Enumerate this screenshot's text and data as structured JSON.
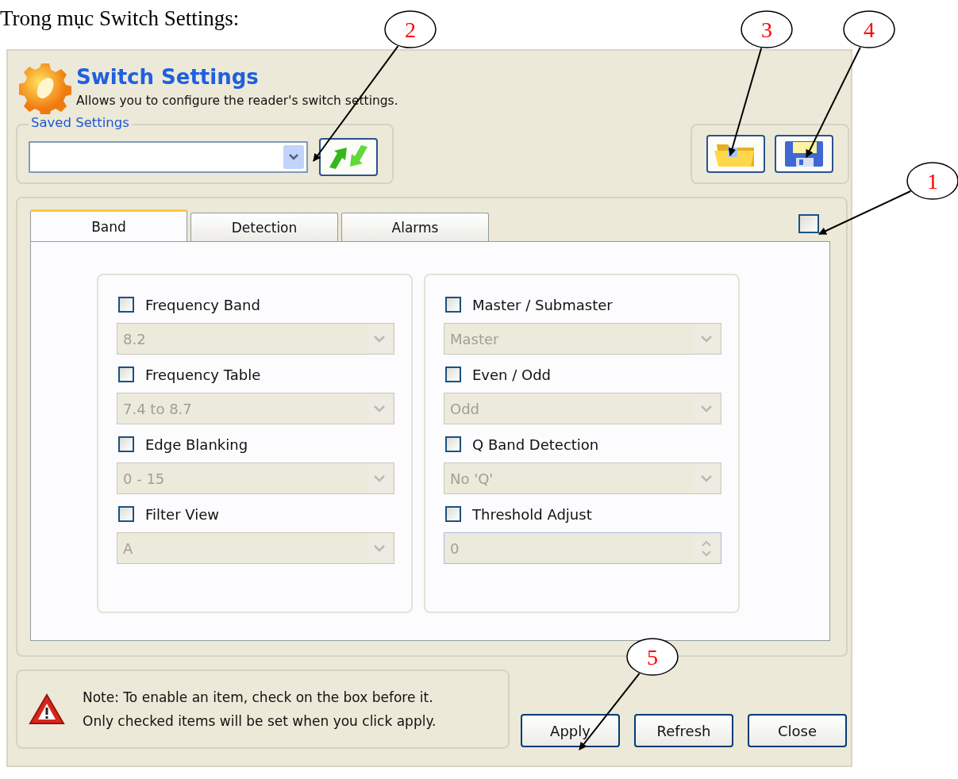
{
  "caption": "Trong mục Switch Settings:",
  "header": {
    "title": "Switch Settings",
    "subtitle": "Allows you to configure the reader's switch settings."
  },
  "saved_settings": {
    "legend": "Saved Settings"
  },
  "tabs": [
    {
      "label": "Band",
      "selected": true
    },
    {
      "label": "Detection",
      "selected": false
    },
    {
      "label": "Alarms",
      "selected": false
    }
  ],
  "select_all_checked": false,
  "settings_columns": [
    [
      {
        "label": "Frequency Band",
        "checked": false,
        "kind": "select",
        "value": "8.2"
      },
      {
        "label": "Frequency Table",
        "checked": false,
        "kind": "select",
        "value": "7.4 to 8.7"
      },
      {
        "label": "Edge Blanking",
        "checked": false,
        "kind": "select",
        "value": "0 - 15"
      },
      {
        "label": "Filter View",
        "checked": false,
        "kind": "select",
        "value": "A"
      }
    ],
    [
      {
        "label": "Master / Submaster",
        "checked": false,
        "kind": "select",
        "value": "Master"
      },
      {
        "label": "Even / Odd",
        "checked": false,
        "kind": "select",
        "value": "Odd"
      },
      {
        "label": "Q Band Detection",
        "checked": false,
        "kind": "select",
        "value": "No 'Q'"
      },
      {
        "label": "Threshold Adjust",
        "checked": false,
        "kind": "spinner",
        "value": "0"
      }
    ]
  ],
  "note": [
    "Note: To enable an item, check on the box before it.",
    "Only checked items will be set when you click apply."
  ],
  "buttons": [
    "Apply",
    "Refresh",
    "Close"
  ],
  "callouts": [
    {
      "label": "2"
    },
    {
      "label": "3"
    },
    {
      "label": "4"
    },
    {
      "label": "1"
    },
    {
      "label": "5"
    }
  ]
}
